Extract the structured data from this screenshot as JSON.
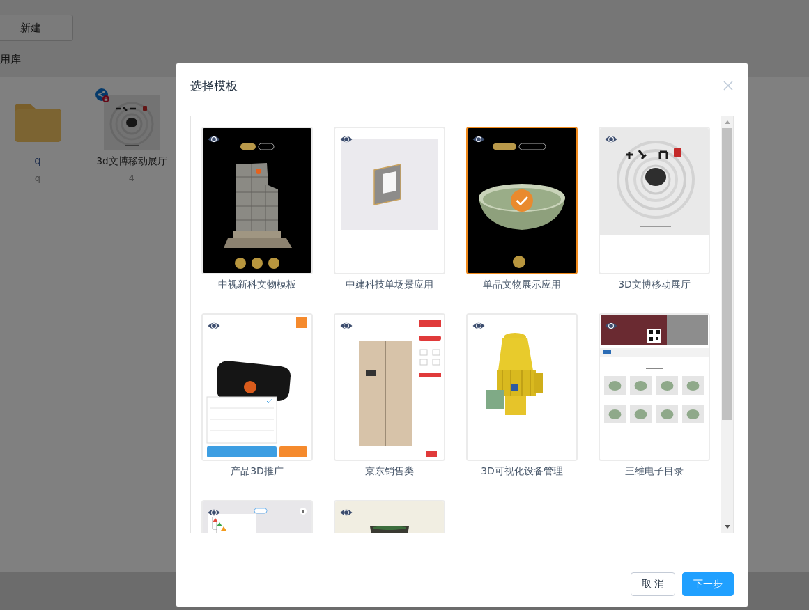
{
  "background_page": {
    "new_button": "新建",
    "tab_label": "用库",
    "items": [
      {
        "kind": "folder",
        "title": "q",
        "subtitle": "q",
        "shared": false,
        "locked": false
      },
      {
        "kind": "project",
        "title": "3d文博移动展厅",
        "subtitle": "4",
        "shared": true,
        "locked": true
      }
    ]
  },
  "dialog": {
    "title": "选择模板",
    "templates": [
      {
        "name": "中视新科文物模板",
        "kind": "ruin",
        "selected": false
      },
      {
        "name": "中建科技单场景应用",
        "kind": "panel",
        "selected": false
      },
      {
        "name": "单品文物展示应用",
        "kind": "bowl",
        "selected": true
      },
      {
        "name": "3D文博移动展厅",
        "kind": "ripple",
        "selected": false
      },
      {
        "name": "产品3D推广",
        "kind": "device",
        "selected": false
      },
      {
        "name": "京东销售类",
        "kind": "fridge",
        "selected": false
      },
      {
        "name": "3D可视化设备管理",
        "kind": "machine",
        "selected": false
      },
      {
        "name": "三维电子目录",
        "kind": "catalog",
        "selected": false
      },
      {
        "kind": "tree",
        "selected": false
      },
      {
        "kind": "pot",
        "selected": false
      }
    ],
    "buttons": [
      {
        "label": "取 消",
        "kind": "secondary"
      },
      {
        "label": "下一步",
        "kind": "primary"
      }
    ]
  }
}
